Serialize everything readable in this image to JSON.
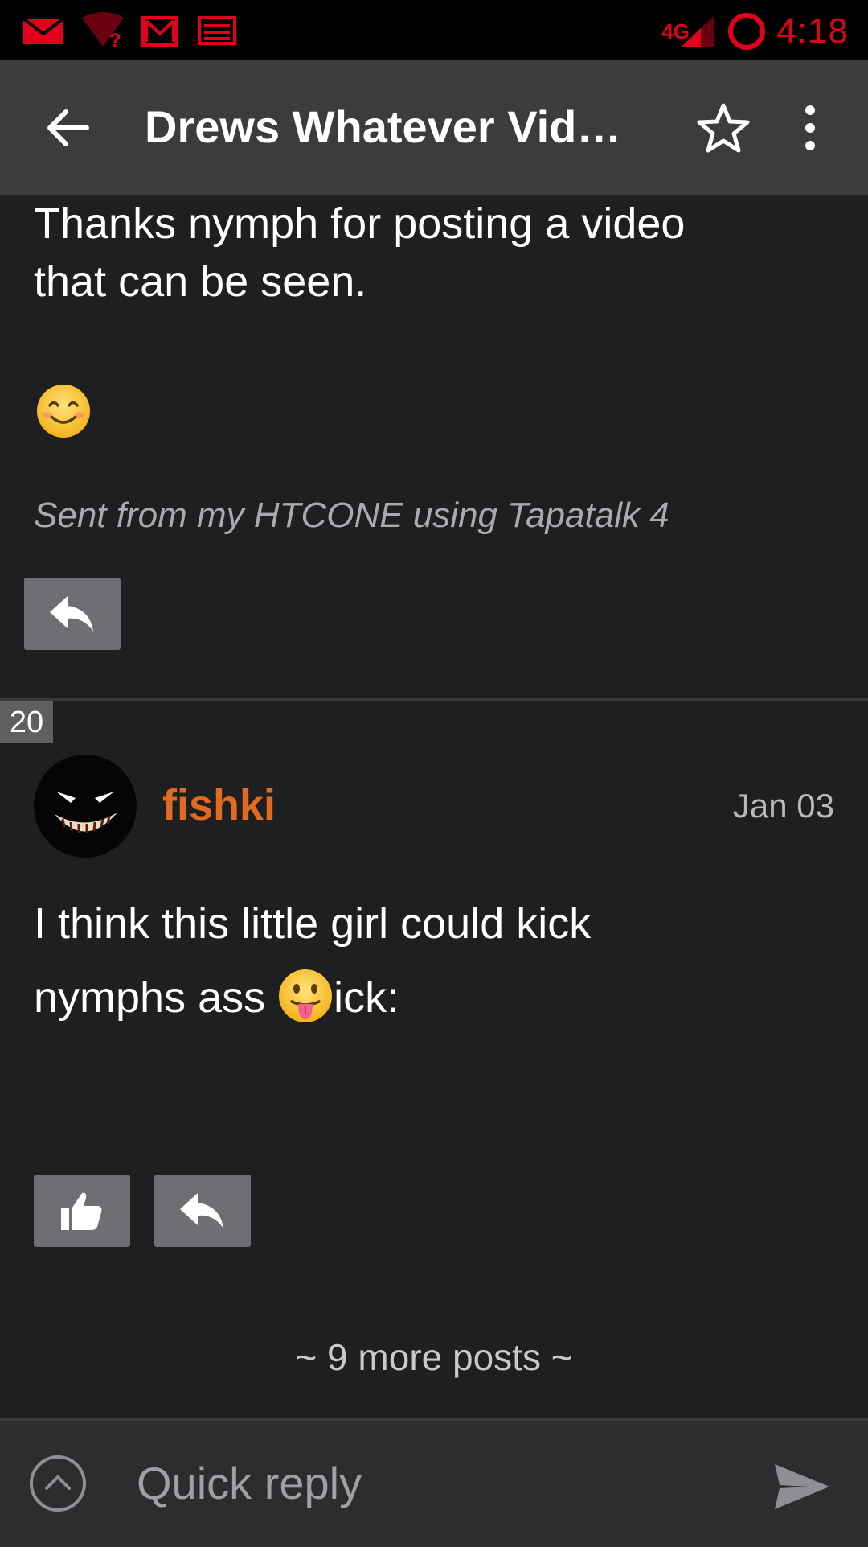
{
  "status_bar": {
    "network": "4G",
    "time": "4:18",
    "icons": [
      "gmail-icon",
      "wifi-unknown-icon",
      "gmail-outline-icon",
      "news-icon",
      "signal-icon",
      "sync-ring-icon"
    ]
  },
  "app_bar": {
    "title": "Drews Whatever Vide…",
    "back_icon": "arrow-back-icon",
    "favorite_icon": "star-outline-icon",
    "overflow_icon": "more-vert-icon"
  },
  "posts": [
    {
      "text_line1": "Thanks nymph for posting a video",
      "text_line2": "that can be seen.",
      "emoji": "😊",
      "signature": "Sent from my HTCONE using Tapatalk 4"
    },
    {
      "number": "20",
      "author": "fishki",
      "date": "Jan 03",
      "text_line1": "I think this little girl could kick",
      "text_line2_before": "nymphs ass ",
      "emoji": "😛",
      "text_line2_after": "ick:"
    }
  ],
  "more_posts": "~ 9 more posts ~",
  "quick_reply": {
    "placeholder": "Quick reply"
  },
  "colors": {
    "accent_red": "#e3001b",
    "author_orange": "#e06a1f",
    "background": "#1e1f21",
    "app_bar": "#3b3c3e"
  }
}
